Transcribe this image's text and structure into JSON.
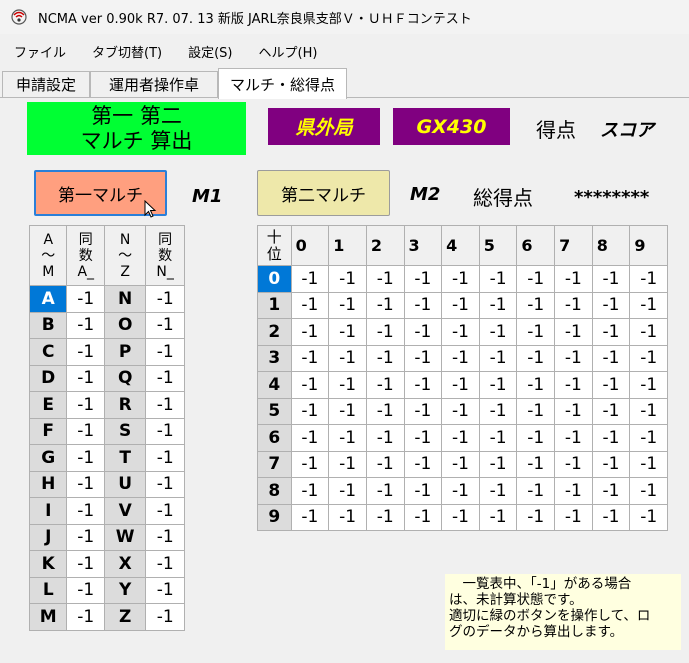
{
  "window": {
    "title": "NCMA ver 0.90k  R7. 07. 13 新版 JARL奈良県支部Ｖ・ＵＨＦコンテスト"
  },
  "menu": [
    "ファイル",
    "タブ切替(T)",
    "設定(S)",
    "ヘルプ(H)"
  ],
  "tabs": [
    "申請設定",
    "運用者操作卓",
    "マルチ・総得点"
  ],
  "top": {
    "calc_line1": "第一 第二",
    "calc_line2": "マルチ 算出",
    "out_of_pref": "県外局",
    "gx": "GX430",
    "score_label": "得点",
    "score_value": "スコア"
  },
  "buttons": {
    "m1": "第一マルチ",
    "m2": "第二マルチ"
  },
  "labels": {
    "m1": "M1",
    "m2": "M2",
    "total_label": "総得点",
    "total_value": "********"
  },
  "left_table": {
    "headers": [
      [
        "A",
        "～",
        "M"
      ],
      [
        "同",
        "数",
        "A_"
      ],
      [
        "N",
        "～",
        "Z"
      ],
      [
        "同",
        "数",
        "N_"
      ]
    ],
    "rows": [
      {
        "l": "A",
        "lv": "-1",
        "r": "N",
        "rv": "-1"
      },
      {
        "l": "B",
        "lv": "-1",
        "r": "O",
        "rv": "-1"
      },
      {
        "l": "C",
        "lv": "-1",
        "r": "P",
        "rv": "-1"
      },
      {
        "l": "D",
        "lv": "-1",
        "r": "Q",
        "rv": "-1"
      },
      {
        "l": "E",
        "lv": "-1",
        "r": "R",
        "rv": "-1"
      },
      {
        "l": "F",
        "lv": "-1",
        "r": "S",
        "rv": "-1"
      },
      {
        "l": "G",
        "lv": "-1",
        "r": "T",
        "rv": "-1"
      },
      {
        "l": "H",
        "lv": "-1",
        "r": "U",
        "rv": "-1"
      },
      {
        "l": "I",
        "lv": "-1",
        "r": "V",
        "rv": "-1"
      },
      {
        "l": "J",
        "lv": "-1",
        "r": "W",
        "rv": "-1"
      },
      {
        "l": "K",
        "lv": "-1",
        "r": "X",
        "rv": "-1"
      },
      {
        "l": "L",
        "lv": "-1",
        "r": "Y",
        "rv": "-1"
      },
      {
        "l": "M",
        "lv": "-1",
        "r": "Z",
        "rv": "-1"
      }
    ]
  },
  "right_table": {
    "corner": [
      "十",
      "位"
    ],
    "cols": [
      "0",
      "1",
      "2",
      "3",
      "4",
      "5",
      "6",
      "7",
      "8",
      "9"
    ],
    "rows": [
      "0",
      "1",
      "2",
      "3",
      "4",
      "5",
      "6",
      "7",
      "8",
      "9"
    ],
    "cell_value": "-1"
  },
  "note": {
    "lines": [
      "　一覧表中、「-1」がある場合",
      "は、未計算状態です。",
      "適切に緑のボタンを操作して、ロ",
      "グのデータから算出します。"
    ]
  }
}
